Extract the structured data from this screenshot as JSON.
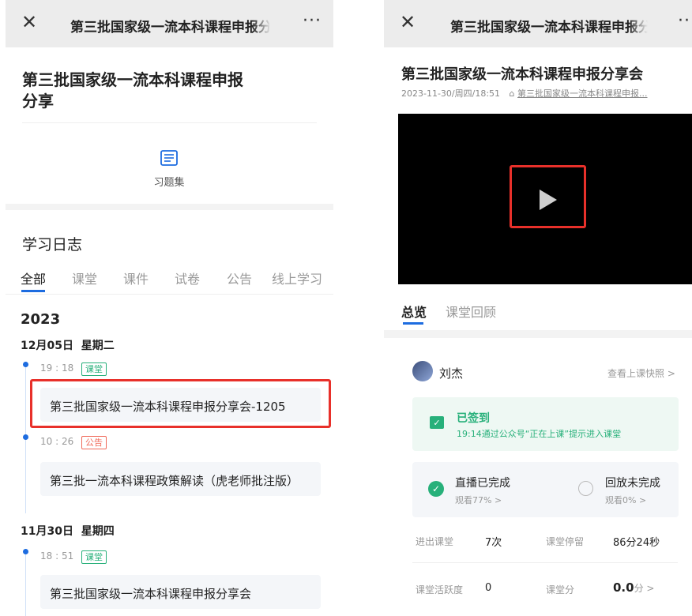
{
  "left": {
    "topbar": {
      "title": "第三批国家级一流本科课程申报分",
      "more": "···"
    },
    "course_title_line1": "第三批国家级一流本科课程申报",
    "course_title_line2": "分享",
    "exercise_label": "习题集",
    "section_title": "学习日志",
    "tabs": [
      "全部",
      "课堂",
      "课件",
      "试卷",
      "公告",
      "线上学习"
    ],
    "year": "2023",
    "days": [
      {
        "date": "12月05日",
        "weekday": "星期二",
        "entries": [
          {
            "time": "19 : 18",
            "tag": "课堂",
            "title": "第三批国家级一流本科课程申报分享会-1205"
          },
          {
            "time": "10 : 26",
            "tag": "公告",
            "title": "第三批一流本科课程政策解读（虎老师批注版）"
          }
        ]
      },
      {
        "date": "11月30日",
        "weekday": "星期四",
        "entries": [
          {
            "time": "18 : 51",
            "tag": "课堂",
            "title": "第三批国家级一流本科课程申报分享会"
          }
        ]
      }
    ]
  },
  "right": {
    "topbar": {
      "title": "第三批国家级一流本科课程申报分",
      "more": "···"
    },
    "lesson_title": "第三批国家级一流本科课程申报分享会",
    "meta_time": "2023-11-30/周四/18:51",
    "meta_course": "第三批国家级一流本科课程申报...",
    "tabs": [
      "总览",
      "课堂回顾"
    ],
    "user_name": "刘杰",
    "snapshot_link": "查看上课快照 >",
    "signin_status": "已签到",
    "signin_detail": "19:14通过公众号“正在上课”提示进入课堂",
    "live_status": "直播已完成",
    "live_watch": "观看77% >",
    "replay_status": "回放未完成",
    "replay_watch": "观看0% >",
    "stats": {
      "enter_label": "进出课堂",
      "enter_value": "7次",
      "stay_label": "课堂停留",
      "stay_value": "86分24秒",
      "activity_label": "课堂活跃度",
      "activity_value": "0",
      "score_label": "课堂分",
      "score_value": "0.0",
      "score_unit": "分 >"
    }
  },
  "colors": {
    "accent_blue": "#1d6ce0",
    "green": "#27b07a",
    "red": "#e8302a",
    "orange_tag": "#f06a5a"
  }
}
